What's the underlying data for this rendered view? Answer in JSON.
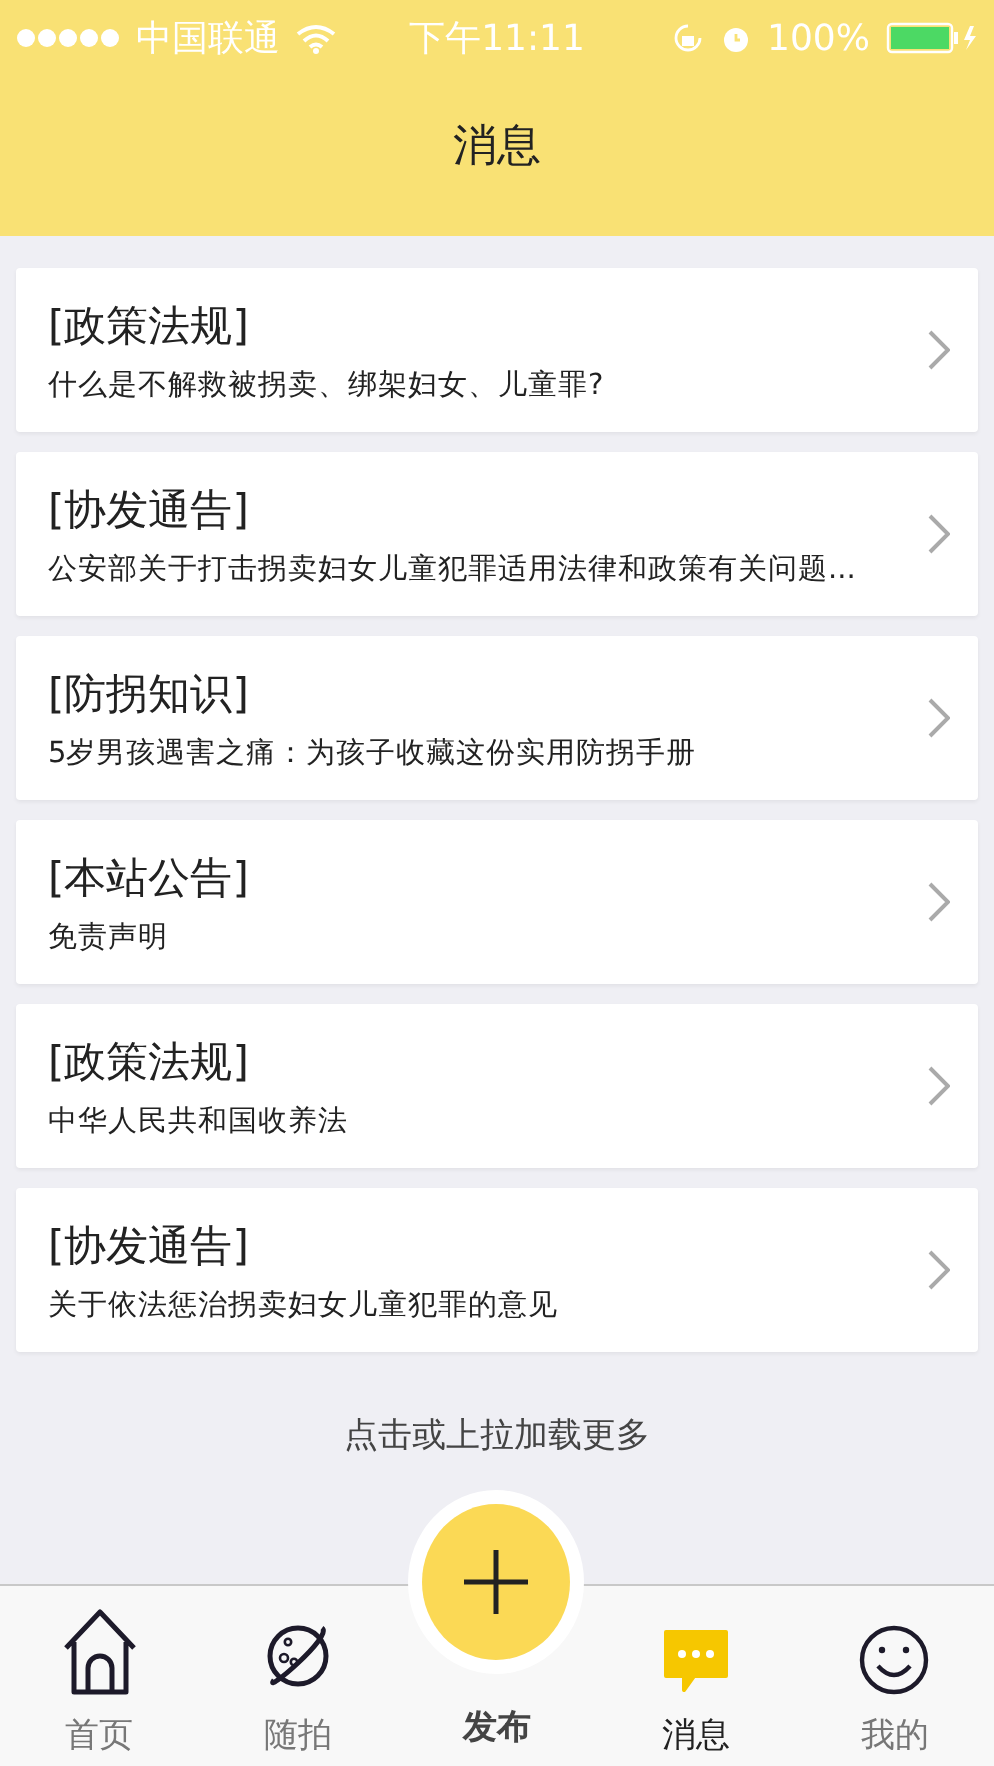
{
  "status_bar": {
    "carrier": "中国联通",
    "time": "下午11:11",
    "battery": "100%"
  },
  "header": {
    "title": "消息"
  },
  "messages": [
    {
      "category": "[政策法规]",
      "summary": "什么是不解救被拐卖、绑架妇女、儿童罪?"
    },
    {
      "category": "[协发通告]",
      "summary": "公安部关于打击拐卖妇女儿童犯罪适用法律和政策有关问题..."
    },
    {
      "category": "[防拐知识]",
      "summary": "5岁男孩遇害之痛：为孩子收藏这份实用防拐手册"
    },
    {
      "category": "[本站公告]",
      "summary": "免责声明"
    },
    {
      "category": "[政策法规]",
      "summary": "中华人民共和国收养法"
    },
    {
      "category": "[协发通告]",
      "summary": "关于依法惩治拐卖妇女儿童犯罪的意见"
    }
  ],
  "load_more": "点击或上拉加载更多",
  "tabs": [
    {
      "kind": "home",
      "label": "首页",
      "selected": false
    },
    {
      "kind": "planet",
      "label": "随拍",
      "selected": false
    },
    {
      "kind": "publish",
      "label": "发布",
      "selected": false
    },
    {
      "kind": "message",
      "label": "消息",
      "selected": true
    },
    {
      "kind": "smile",
      "label": "我的",
      "selected": false
    }
  ]
}
